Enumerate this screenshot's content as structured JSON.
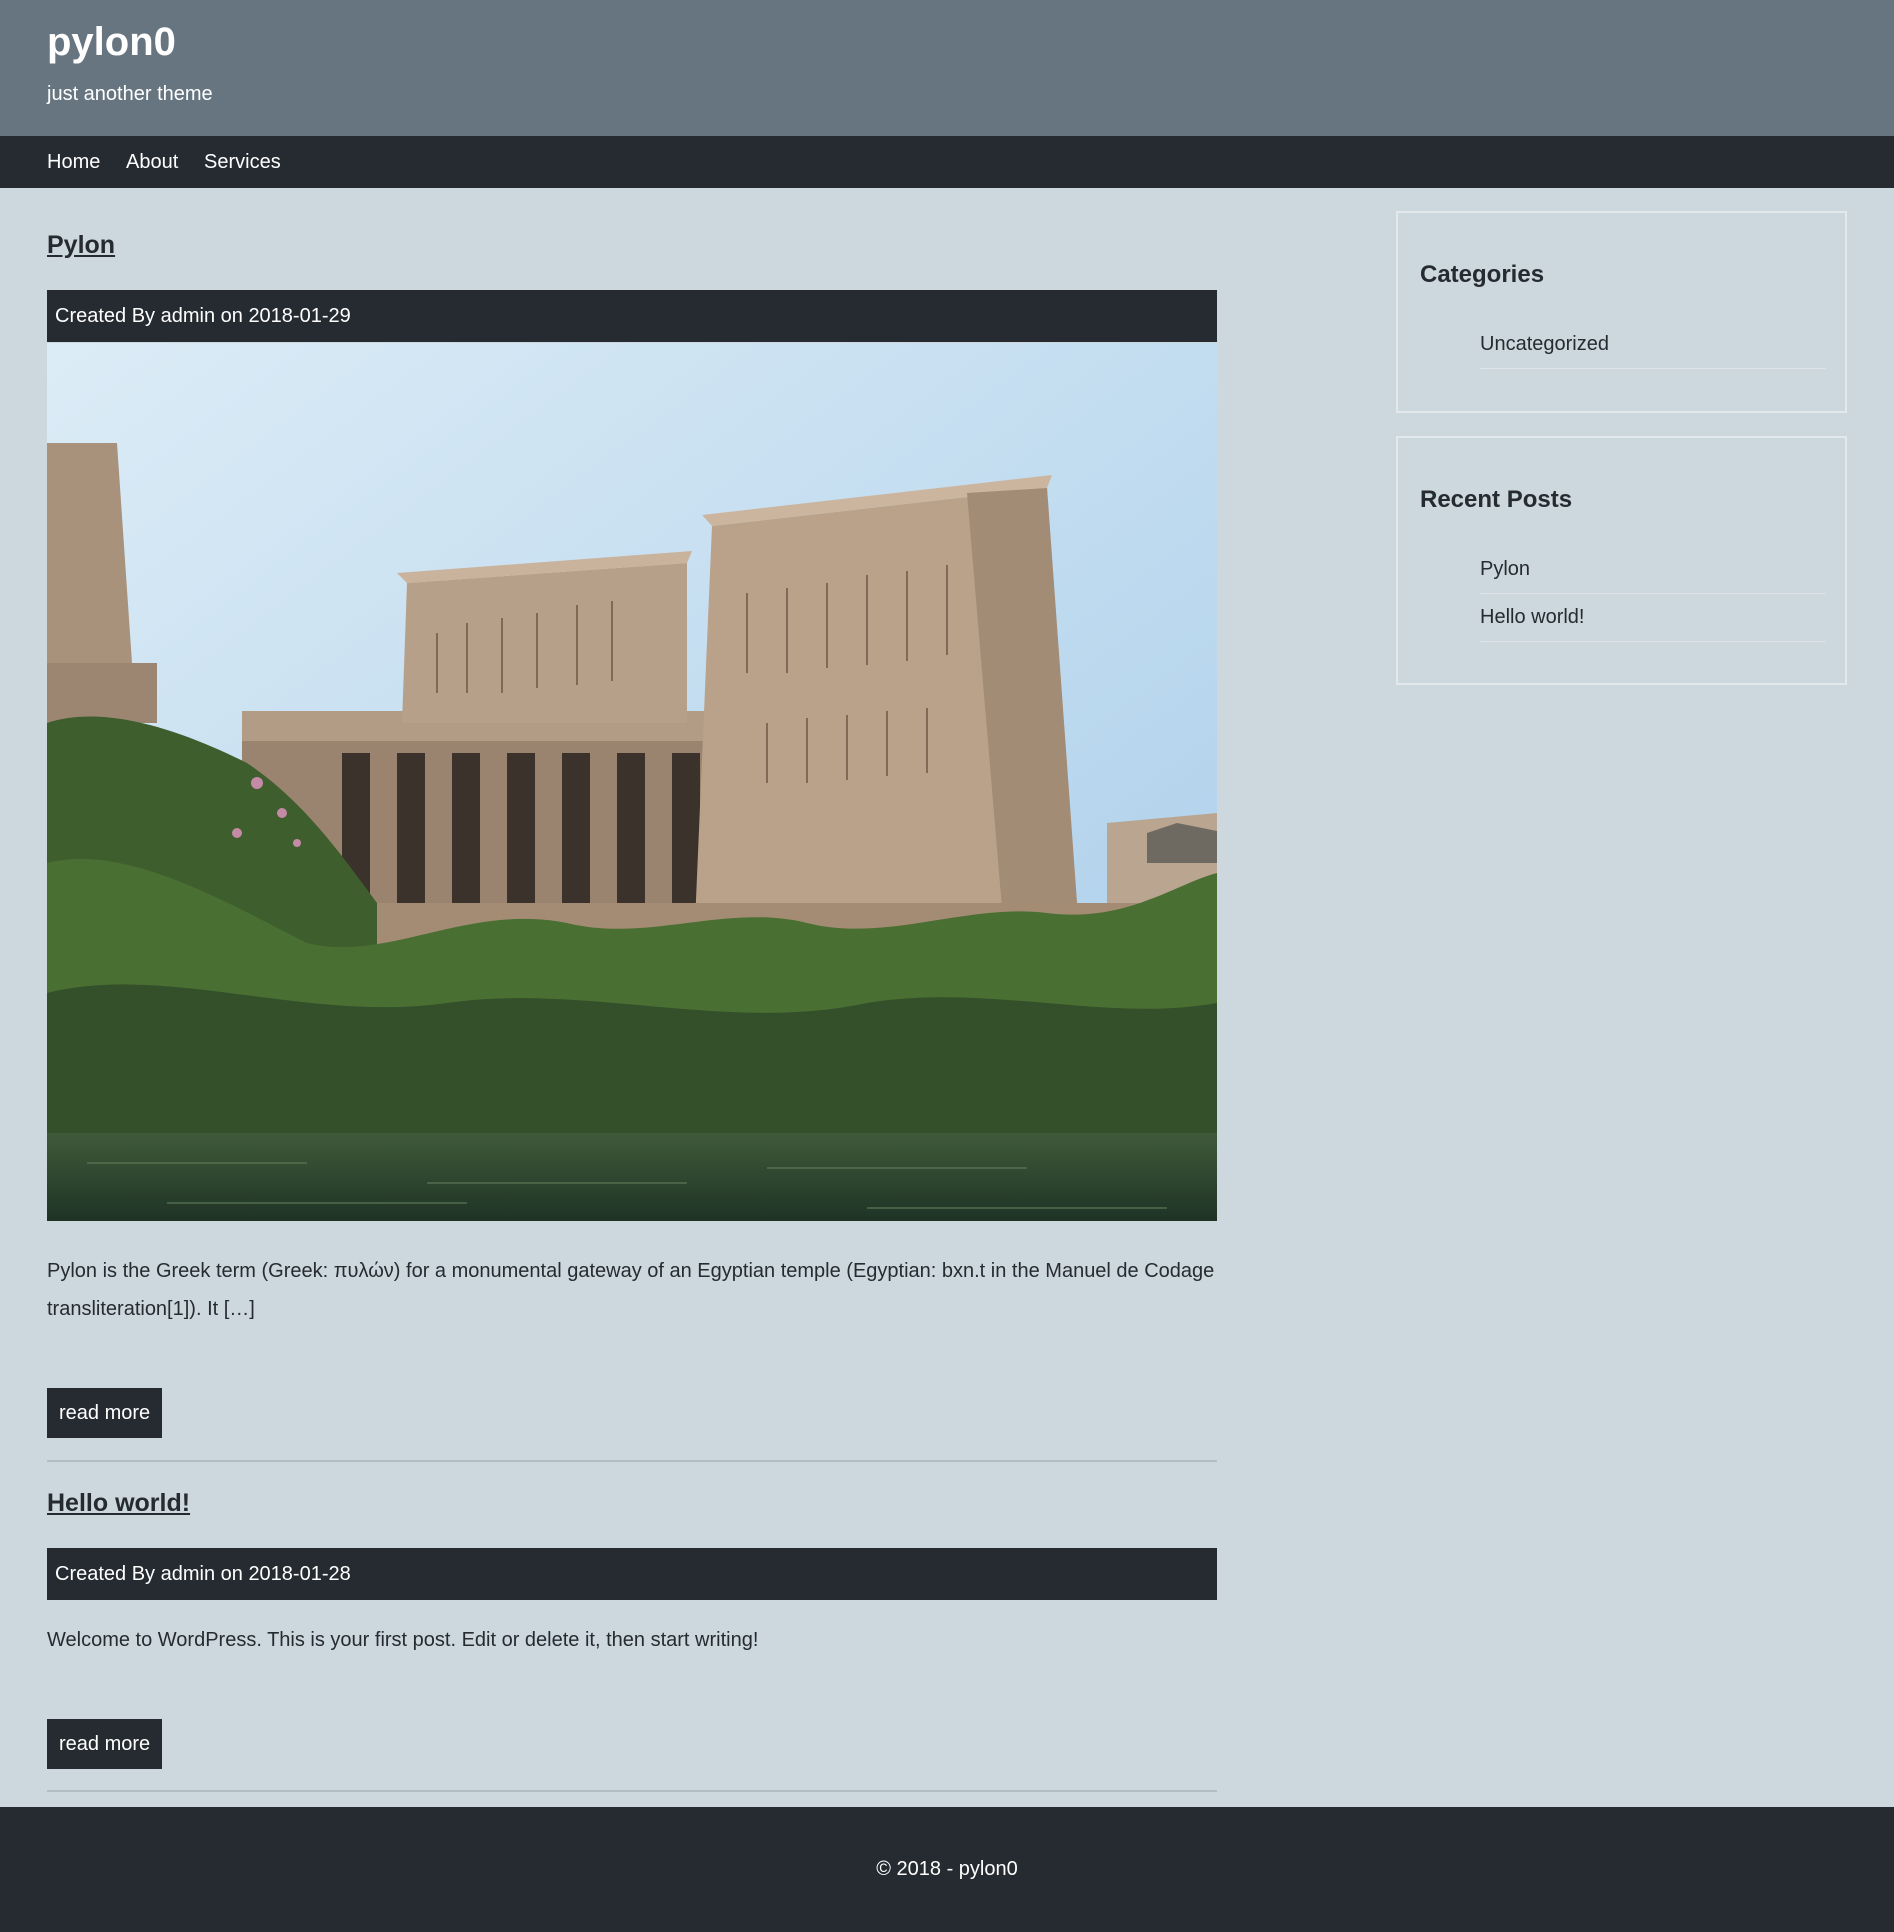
{
  "site": {
    "title": "pylon0",
    "tagline": "just another theme"
  },
  "nav": {
    "items": [
      {
        "label": "Home"
      },
      {
        "label": "About"
      },
      {
        "label": "Services"
      }
    ]
  },
  "posts": [
    {
      "title": "Pylon",
      "meta": "Created By admin on 2018-01-29",
      "excerpt": "Pylon is the Greek term (Greek: πυλών) for a monumental gateway of an Egyptian temple (Egyptian: bxn.t in the Manuel de Codage transliteration[1]). It […]",
      "read_more": "read more"
    },
    {
      "title": "Hello world!",
      "meta": "Created By admin on 2018-01-28",
      "excerpt": "Welcome to WordPress. This is your first post. Edit or delete it, then start writing!",
      "read_more": "read more"
    }
  ],
  "sidebar": {
    "categories": {
      "title": "Categories",
      "items": [
        {
          "label": "Uncategorized"
        }
      ]
    },
    "recent_posts": {
      "title": "Recent Posts",
      "items": [
        {
          "label": "Pylon"
        },
        {
          "label": "Hello world!"
        }
      ]
    }
  },
  "footer": {
    "text": "© 2018 - pylon0"
  },
  "colors": {
    "header_bg": "#677581",
    "nav_bg": "#262b31",
    "page_bg": "#cdd7de",
    "footer_bg": "#262b31"
  }
}
